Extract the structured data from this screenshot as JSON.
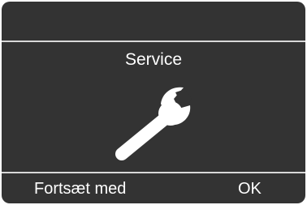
{
  "screen": {
    "title": "Service",
    "icon": "wrench-icon"
  },
  "softkeys": {
    "left_label": "Fortsæt med",
    "right_label": "OK"
  },
  "colors": {
    "background": "#333333",
    "foreground": "#ffffff",
    "divider": "#d8d8d8"
  }
}
